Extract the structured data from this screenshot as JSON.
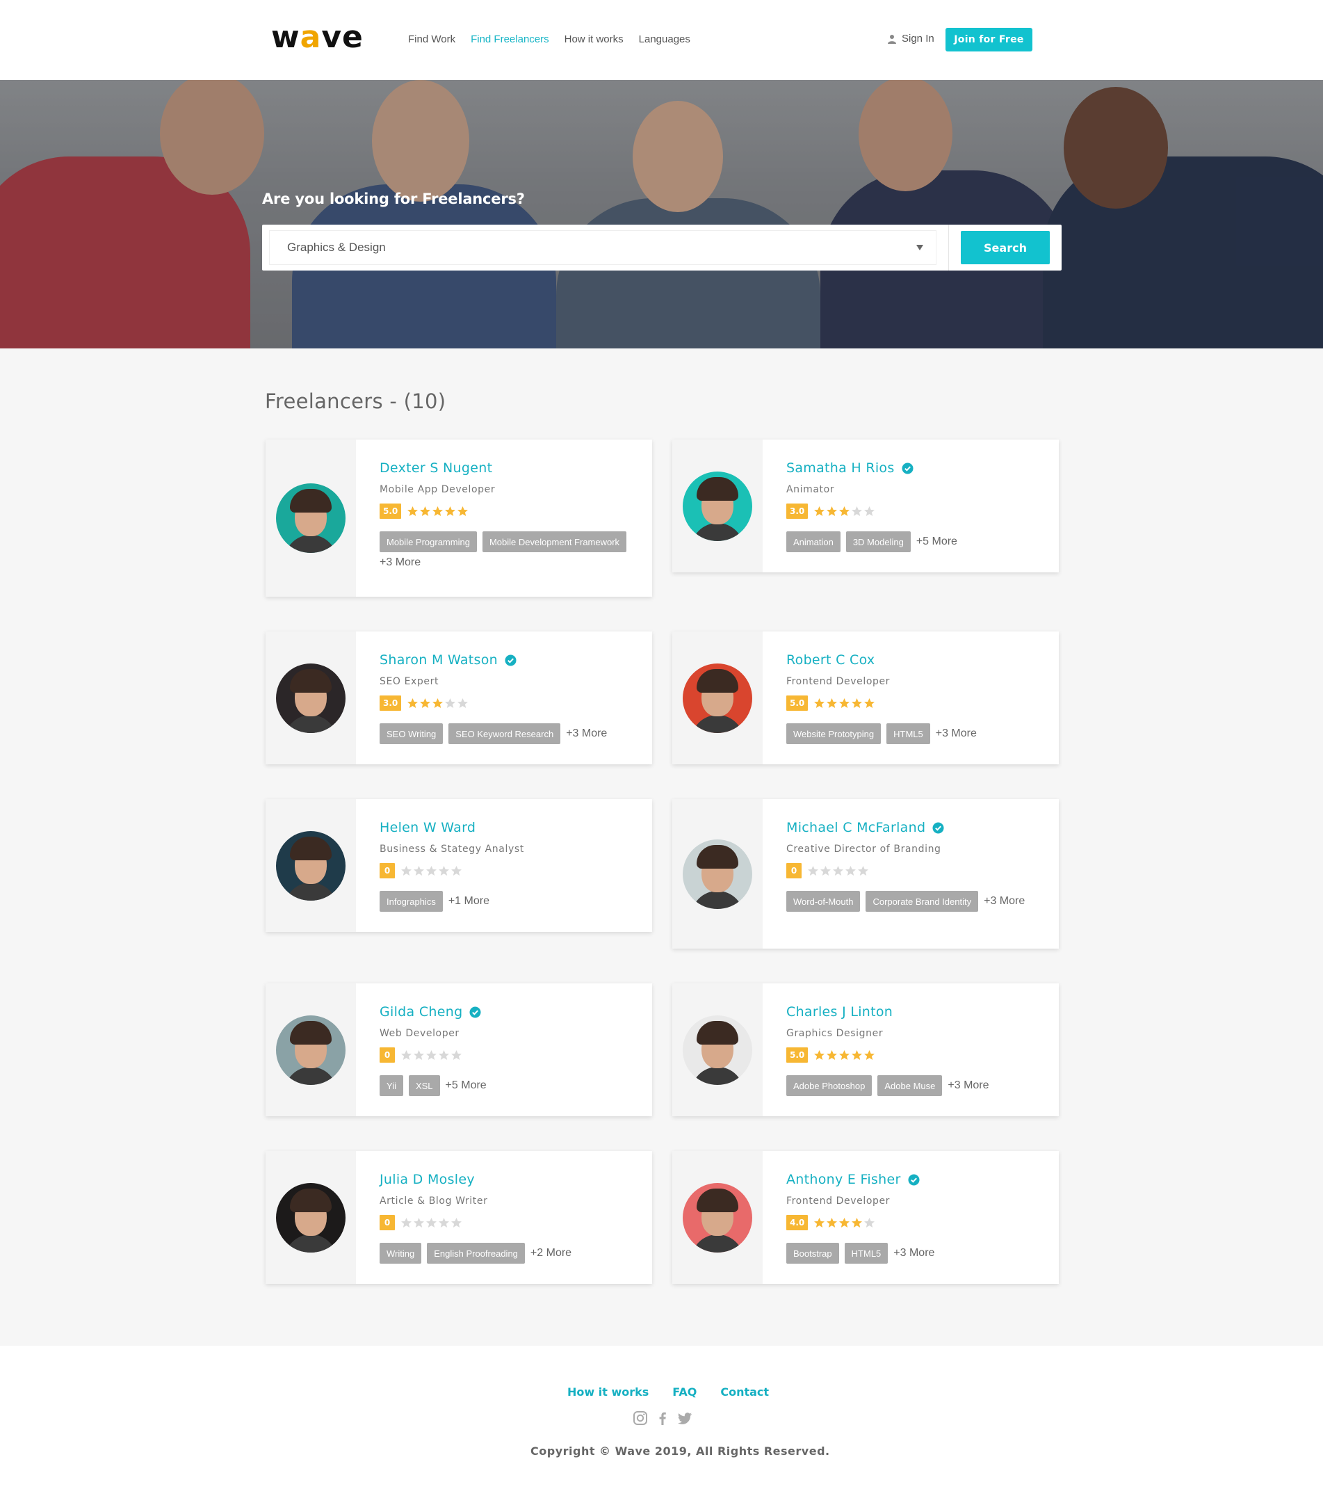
{
  "header": {
    "logo": {
      "part1": "w",
      "part2": "a",
      "part3": "ve"
    },
    "nav": [
      {
        "label": "Find Work",
        "active": false
      },
      {
        "label": "Find Freelancers",
        "active": true
      },
      {
        "label": "How it works",
        "active": false
      },
      {
        "label": "Languages",
        "active": false
      }
    ],
    "sign_in": "Sign In",
    "join": "Join for Free"
  },
  "hero": {
    "title": "Are you looking for Freelancers?",
    "select_value": "Graphics & Design",
    "search_label": "Search"
  },
  "main": {
    "title": "Freelancers - (10)",
    "freelancers": [
      {
        "name": "Dexter S Nugent",
        "verified": false,
        "role": "Mobile App Developer",
        "score": "5.0",
        "stars": 5,
        "tags": [
          "Mobile Programming",
          "Mobile Development Framework"
        ],
        "more": "+3 More",
        "avatar_bg": "#1aa89b"
      },
      {
        "name": "Samatha H Rios",
        "verified": true,
        "role": "Animator",
        "score": "3.0",
        "stars": 3,
        "tags": [
          "Animation",
          "3D Modeling"
        ],
        "more": "+5 More",
        "avatar_bg": "#1bc0b5"
      },
      {
        "name": "Sharon M Watson",
        "verified": true,
        "role": "SEO Expert",
        "score": "3.0",
        "stars": 3,
        "tags": [
          "SEO Writing",
          "SEO Keyword Research"
        ],
        "more": "+3 More",
        "avatar_bg": "#2b2628"
      },
      {
        "name": "Robert C Cox",
        "verified": false,
        "role": "Frontend Developer",
        "score": "5.0",
        "stars": 5,
        "tags": [
          "Website Prototyping",
          "HTML5"
        ],
        "more": "+3 More",
        "avatar_bg": "#d9452e"
      },
      {
        "name": "Helen W Ward",
        "verified": false,
        "role": "Business & Stategy Analyst",
        "score": "0",
        "stars": 0,
        "tags": [
          "Infographics"
        ],
        "more": "+1 More",
        "avatar_bg": "#1f3b4a"
      },
      {
        "name": "Michael C McFarland",
        "verified": true,
        "role": "Creative Director of Branding",
        "score": "0",
        "stars": 0,
        "tags": [
          "Word-of-Mouth",
          "Corporate Brand Identity"
        ],
        "more": "+3 More",
        "avatar_bg": "#c9d3d4"
      },
      {
        "name": "Gilda Cheng",
        "verified": true,
        "role": "Web Developer",
        "score": "0",
        "stars": 0,
        "tags": [
          "Yii",
          "XSL"
        ],
        "more": "+5 More",
        "avatar_bg": "#8aa2a6"
      },
      {
        "name": "Charles J Linton",
        "verified": false,
        "role": "Graphics Designer",
        "score": "5.0",
        "stars": 5,
        "tags": [
          "Adobe Photoshop",
          "Adobe Muse"
        ],
        "more": "+3 More",
        "avatar_bg": "#e9e9e9"
      },
      {
        "name": "Julia D Mosley",
        "verified": false,
        "role": "Article & Blog Writer",
        "score": "0",
        "stars": 0,
        "tags": [
          "Writing",
          "English Proofreading"
        ],
        "more": "+2 More",
        "avatar_bg": "#1c1a1a"
      },
      {
        "name": "Anthony E Fisher",
        "verified": true,
        "role": "Frontend Developer",
        "score": "4.0",
        "stars": 4,
        "tags": [
          "Bootstrap",
          "HTML5"
        ],
        "more": "+3 More",
        "avatar_bg": "#e86a6a"
      }
    ]
  },
  "footer": {
    "links": [
      "How it works",
      "FAQ",
      "Contact"
    ],
    "social": [
      "instagram-icon",
      "facebook-icon",
      "twitter-icon"
    ],
    "copyright": "Copyright © Wave 2019,  All Rights Reserved."
  },
  "colors": {
    "accent": "#12c2cf",
    "link": "#16b0c2",
    "star": "#f7b733",
    "star_empty": "#d8d8d8",
    "tag": "#a9a9a9"
  }
}
